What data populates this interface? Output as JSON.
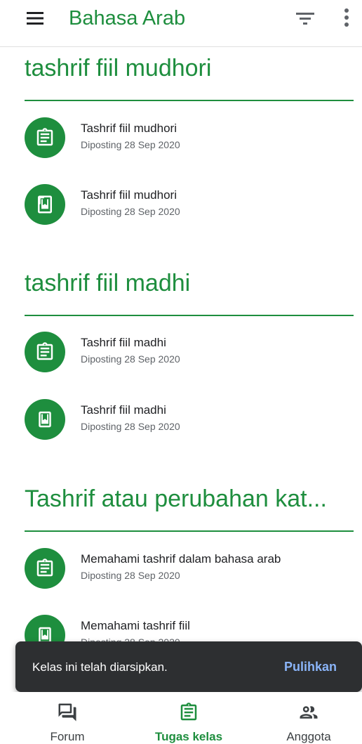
{
  "appbar": {
    "title": "Bahasa Arab",
    "icons": [
      "menu-icon",
      "filter-icon",
      "more-vert-icon"
    ]
  },
  "sections": [
    {
      "title": "tashrif fiil mudhori",
      "items": [
        {
          "icon": "assignment-icon",
          "title": "Tashrif fiil mudhori",
          "subtitle": "Diposting 28 Sep 2020"
        },
        {
          "icon": "material-book-icon",
          "title": "Tashrif fiil mudhori",
          "subtitle": "Diposting 28 Sep 2020"
        }
      ]
    },
    {
      "title": "tashrif fiil madhi",
      "items": [
        {
          "icon": "assignment-icon",
          "title": "Tashrif fiil madhi",
          "subtitle": "Diposting 28 Sep 2020"
        },
        {
          "icon": "material-book-icon",
          "title": "Tashrif fiil madhi",
          "subtitle": "Diposting 28 Sep 2020"
        }
      ]
    },
    {
      "title": "Tashrif atau perubahan kat...",
      "items": [
        {
          "icon": "assignment-icon",
          "title": "Memahami tashrif dalam bahasa arab",
          "subtitle": "Diposting 28 Sep 2020"
        },
        {
          "icon": "material-book-icon",
          "title": "Memahami tashrif fiil",
          "subtitle": "Diposting 28 Sep 2020"
        }
      ]
    }
  ],
  "snackbar": {
    "message": "Kelas ini telah diarsipkan.",
    "action": "Pulihkan"
  },
  "bottom_nav": {
    "items": [
      {
        "label": "Forum",
        "icon": "forum-icon",
        "active": false
      },
      {
        "label": "Tugas kelas",
        "icon": "assignment-icon",
        "active": true
      },
      {
        "label": "Anggota",
        "icon": "people-icon",
        "active": false
      }
    ]
  },
  "colors": {
    "brand_green": "#1e8e3e",
    "snackbar_bg": "#2d2f31",
    "snackbar_action": "#8ab4f8"
  }
}
